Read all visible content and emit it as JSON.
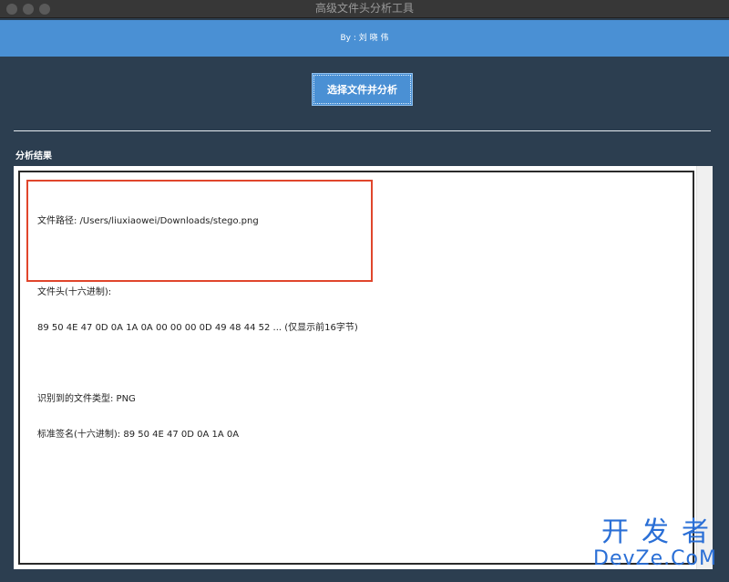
{
  "window": {
    "title": "高级文件头分析工具"
  },
  "header": {
    "author": "By : 刘 晓 伟"
  },
  "toolbar": {
    "select_label": "选择文件并分析"
  },
  "results": {
    "section_label": "分析结果",
    "lines": [
      "文件路径: /Users/liuxiaowei/Downloads/stego.png",
      "",
      "文件头(十六进制):",
      "89 50 4E 47 0D 0A 1A 0A 00 00 00 0D 49 48 44 52 ... (仅显示前16字节)",
      "",
      "识别到的文件类型: PNG",
      "标准签名(十六进制): 89 50 4E 47 0D 0A 1A 0A"
    ]
  },
  "watermark": {
    "line1": "开发者",
    "line2": "DevZe.CoM"
  },
  "colors": {
    "background": "#2c3e50",
    "accent": "#4a90d4",
    "highlight": "#e0462c"
  }
}
